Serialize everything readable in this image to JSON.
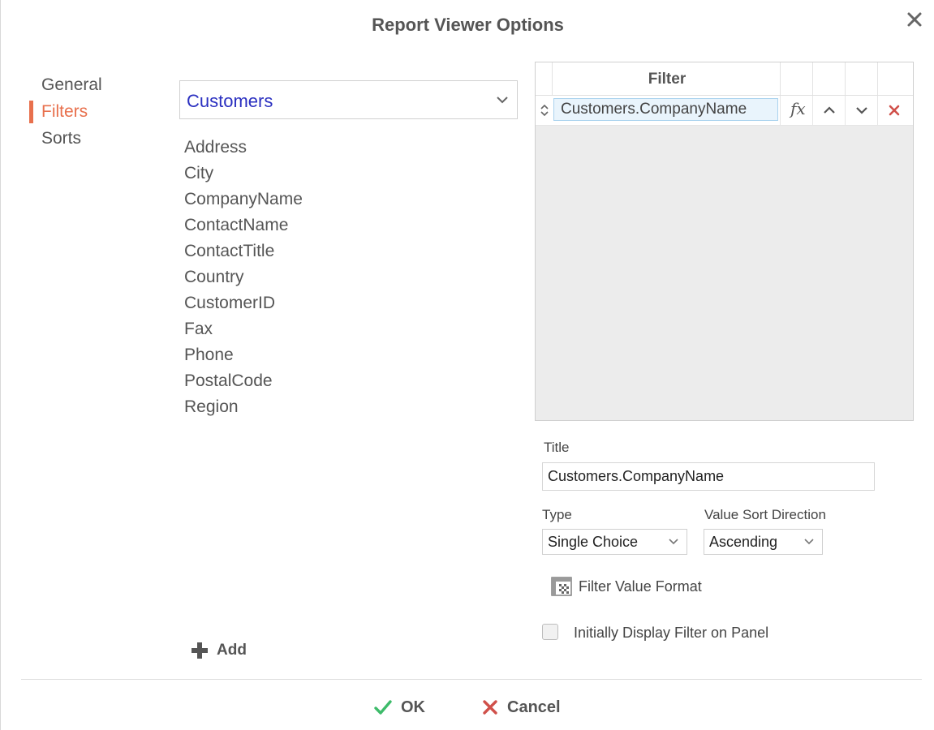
{
  "dialog": {
    "title": "Report Viewer Options",
    "close_icon": "close-icon"
  },
  "nav": {
    "items": [
      {
        "label": "General",
        "active": false
      },
      {
        "label": "Filters",
        "active": true
      },
      {
        "label": "Sorts",
        "active": false
      }
    ],
    "accent_color": "#e8704d"
  },
  "table_select": {
    "value": "Customers",
    "value_color": "#2a2fc0"
  },
  "fields": [
    "Address",
    "City",
    "CompanyName",
    "ContactName",
    "ContactTitle",
    "Country",
    "CustomerID",
    "Fax",
    "Phone",
    "PostalCode",
    "Region"
  ],
  "add_button": {
    "label": "Add"
  },
  "filter_grid": {
    "header": "Filter",
    "rows": [
      {
        "field": "Customers.CompanyName",
        "fx_label": "fx"
      }
    ]
  },
  "properties": {
    "title_label": "Title",
    "title_value": "Customers.CompanyName",
    "type_label": "Type",
    "type_value": "Single Choice",
    "sort_label": "Value Sort Direction",
    "sort_value": "Ascending",
    "format_label": "Filter Value Format",
    "checkbox_label": "Initially Display Filter on Panel",
    "checkbox_checked": false
  },
  "footer": {
    "ok_label": "OK",
    "cancel_label": "Cancel",
    "ok_color": "#3dbb6a",
    "cancel_color": "#d0504a"
  }
}
